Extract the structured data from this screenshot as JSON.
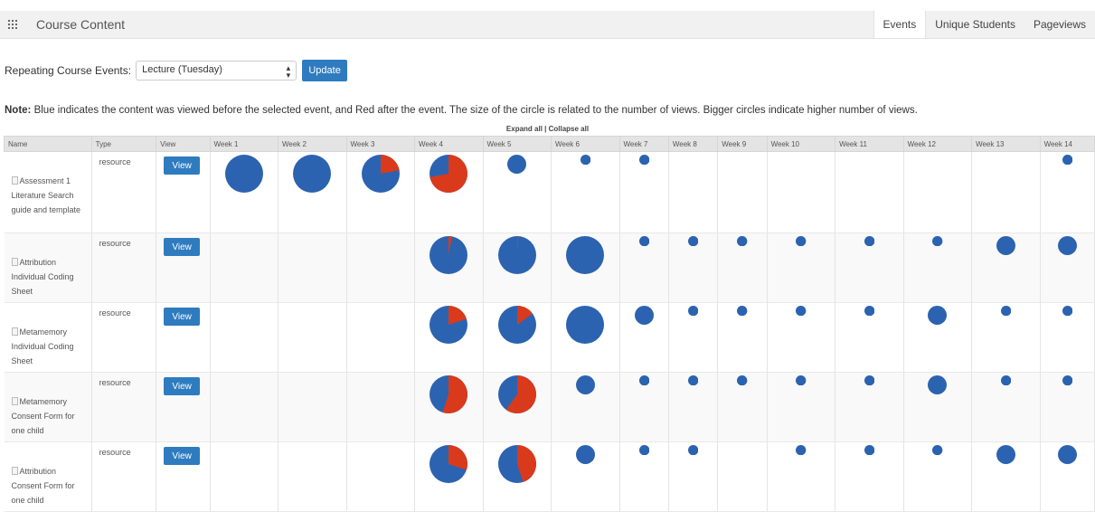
{
  "header": {
    "title": "Course Content",
    "tabs": [
      {
        "label": "Events",
        "active": true
      },
      {
        "label": "Unique Students",
        "active": false
      },
      {
        "label": "Pageviews",
        "active": false
      }
    ],
    "icon": "grid-icon"
  },
  "controls": {
    "label": "Repeating Course Events:",
    "selected": "Lecture (Tuesday)",
    "update_label": "Update"
  },
  "note": {
    "bold": "Note:",
    "text": " Blue indicates the content was viewed before the selected event, and Red after the event. The size of the circle is related to the number of views. Bigger circles indicate higher number of views."
  },
  "expand": {
    "expand_label": "Expand all",
    "separator": " | ",
    "collapse_label": "Collapse all"
  },
  "colors": {
    "before": "#2b63b0",
    "after": "#d93a1c",
    "accent": "#2f7bbf"
  },
  "table": {
    "columns": [
      "Name",
      "Type",
      "View",
      "Week 1",
      "Week 2",
      "Week 3",
      "Week 4",
      "Week 5",
      "Week 6",
      "Week 7",
      "Week 8",
      "Week 9",
      "Week 10",
      "Week 11",
      "Week 12",
      "Week 13",
      "Week 14"
    ],
    "view_label": "View",
    "rows": [
      {
        "name": "Assessment 1 Literature Search guide and template",
        "type": "resource",
        "cells": [
          {
            "week": 1,
            "size": 1.0,
            "red": 0
          },
          {
            "week": 2,
            "size": 1.0,
            "red": 0
          },
          {
            "week": 3,
            "size": 1.0,
            "red": 0.22
          },
          {
            "week": 4,
            "size": 1.0,
            "red": 0.72
          },
          {
            "week": 5,
            "size": 0.5,
            "red": 0
          },
          {
            "week": 6,
            "size": 0.27,
            "red": 0
          },
          {
            "week": 7,
            "size": 0.27,
            "red": 0
          },
          {
            "week": 14,
            "size": 0.27,
            "red": 0
          }
        ]
      },
      {
        "name": "Attribution Individual Coding Sheet",
        "type": "resource",
        "cells": [
          {
            "week": 4,
            "size": 1.0,
            "red": 0.03
          },
          {
            "week": 5,
            "size": 1.0,
            "red": 0.01
          },
          {
            "week": 6,
            "size": 1.0,
            "red": 0
          },
          {
            "week": 7,
            "size": 0.27,
            "red": 0
          },
          {
            "week": 8,
            "size": 0.27,
            "red": 0
          },
          {
            "week": 9,
            "size": 0.27,
            "red": 0
          },
          {
            "week": 10,
            "size": 0.27,
            "red": 0
          },
          {
            "week": 11,
            "size": 0.27,
            "red": 0
          },
          {
            "week": 12,
            "size": 0.27,
            "red": 0
          },
          {
            "week": 13,
            "size": 0.5,
            "red": 0
          },
          {
            "week": 14,
            "size": 0.5,
            "red": 0
          }
        ]
      },
      {
        "name": "Metamemory Individual Coding Sheet",
        "type": "resource",
        "cells": [
          {
            "week": 4,
            "size": 1.0,
            "red": 0.2
          },
          {
            "week": 5,
            "size": 1.0,
            "red": 0.15
          },
          {
            "week": 6,
            "size": 1.0,
            "red": 0
          },
          {
            "week": 7,
            "size": 0.5,
            "red": 0
          },
          {
            "week": 8,
            "size": 0.27,
            "red": 0
          },
          {
            "week": 9,
            "size": 0.27,
            "red": 0
          },
          {
            "week": 10,
            "size": 0.27,
            "red": 0
          },
          {
            "week": 11,
            "size": 0.27,
            "red": 0
          },
          {
            "week": 12,
            "size": 0.5,
            "red": 0
          },
          {
            "week": 13,
            "size": 0.27,
            "red": 0
          },
          {
            "week": 14,
            "size": 0.27,
            "red": 0
          }
        ]
      },
      {
        "name": "Metamemory Consent Form for one child",
        "type": "resource",
        "cells": [
          {
            "week": 4,
            "size": 1.0,
            "red": 0.55
          },
          {
            "week": 5,
            "size": 1.0,
            "red": 0.6
          },
          {
            "week": 6,
            "size": 0.5,
            "red": 0
          },
          {
            "week": 7,
            "size": 0.27,
            "red": 0
          },
          {
            "week": 8,
            "size": 0.27,
            "red": 0
          },
          {
            "week": 9,
            "size": 0.27,
            "red": 0
          },
          {
            "week": 10,
            "size": 0.27,
            "red": 0
          },
          {
            "week": 11,
            "size": 0.27,
            "red": 0
          },
          {
            "week": 12,
            "size": 0.5,
            "red": 0
          },
          {
            "week": 13,
            "size": 0.27,
            "red": 0
          },
          {
            "week": 14,
            "size": 0.27,
            "red": 0
          }
        ]
      },
      {
        "name": "Attribution Consent Form for one child",
        "type": "resource",
        "cells": [
          {
            "week": 4,
            "size": 1.0,
            "red": 0.3
          },
          {
            "week": 5,
            "size": 1.0,
            "red": 0.45
          },
          {
            "week": 6,
            "size": 0.5,
            "red": 0
          },
          {
            "week": 7,
            "size": 0.27,
            "red": 0
          },
          {
            "week": 8,
            "size": 0.27,
            "red": 0
          },
          {
            "week": 10,
            "size": 0.27,
            "red": 0
          },
          {
            "week": 11,
            "size": 0.27,
            "red": 0
          },
          {
            "week": 12,
            "size": 0.27,
            "red": 0
          },
          {
            "week": 13,
            "size": 0.5,
            "red": 0
          },
          {
            "week": 14,
            "size": 0.5,
            "red": 0
          }
        ]
      }
    ]
  }
}
